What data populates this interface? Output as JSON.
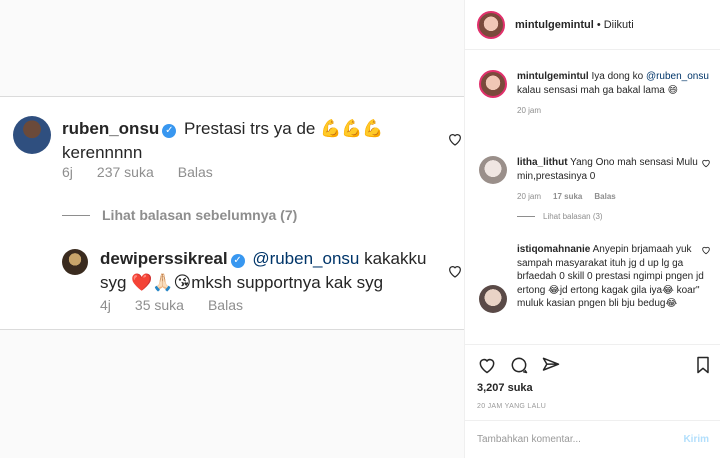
{
  "left": {
    "comment1": {
      "username": "ruben_onsu",
      "text": "Prestasi trs ya de 💪💪💪 kerennnnn",
      "time": "6j",
      "likes": "237 suka",
      "reply": "Balas"
    },
    "see_replies": "Lihat balasan sebelumnya (7)",
    "comment2": {
      "username": "dewiperssikreal",
      "mention": "@ruben_onsu",
      "text": " kakakku syg ❤️🙏🏻😘mksh supportnya kak syg",
      "time": "4j",
      "likes": "35 suka",
      "reply": "Balas"
    }
  },
  "right": {
    "header": {
      "username": "mintulgemintul",
      "dot": "•",
      "follow": "Diikuti"
    },
    "comments": [
      {
        "username": "mintulgemintul",
        "mention": "@ruben_onsu",
        "pre": "Iya dong ko ",
        "post": " kalau sensasi mah ga bakal lama 😄",
        "time": "20 jam"
      },
      {
        "username": "litha_lithut",
        "text": "Yang Ono mah sensasi Mulu min,prestasinya 0",
        "time": "20 jam",
        "likes": "17 suka",
        "reply": "Balas"
      },
      {
        "username": "istiqomahnanie",
        "text": "Anyepin brjamaah yuk sampah masyarakat ituh jg d up lg ga brfaedah 0 skill 0 prestasi ngimpi pngen jd ertong 😂jd ertong kagak gila iya😂 koar\" muluk kasian pngen bli bju bedug😂"
      }
    ],
    "see_replies": "Lihat balasan (3)",
    "likes": "3,207 suka",
    "posted": "20 JAM YANG LALU",
    "comment_placeholder": "Tambahkan komentar...",
    "send": "Kirim"
  },
  "colors": {
    "link": "#003569",
    "verified": "#3897f0",
    "muted": "#8e8e8e",
    "send_disabled": "#b2dffc"
  }
}
